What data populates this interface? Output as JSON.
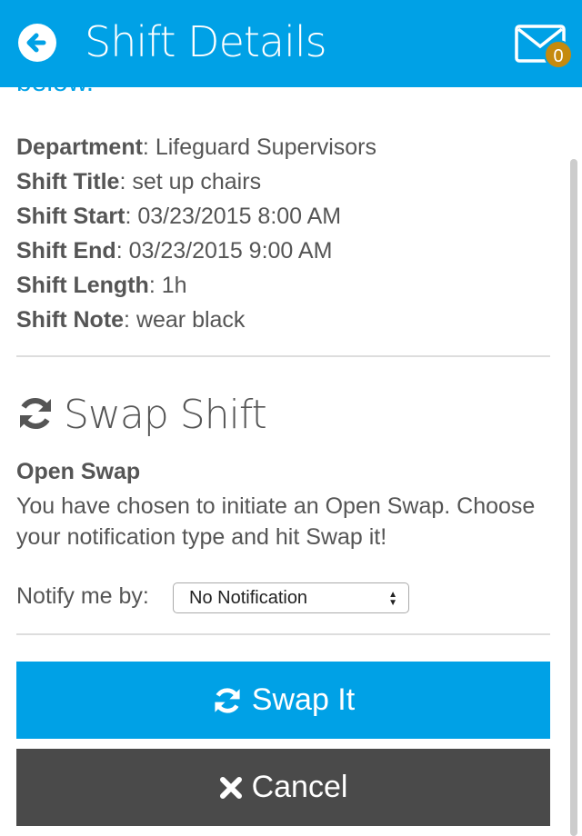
{
  "header": {
    "title": "Shift Details",
    "mail_count": "0"
  },
  "intro_cut": "below.",
  "details": [
    {
      "label": "Department",
      "value": ": Lifeguard Supervisors"
    },
    {
      "label": "Shift Title",
      "value": ": set up chairs"
    },
    {
      "label": "Shift Start",
      "value": ": 03/23/2015 8:00 AM"
    },
    {
      "label": "Shift End",
      "value": ": 03/23/2015 9:00 AM"
    },
    {
      "label": "Shift Length",
      "value": ": 1h"
    },
    {
      "label": "Shift Note",
      "value": ": wear black"
    }
  ],
  "swap": {
    "heading": "Swap Shift",
    "subheading": "Open Swap",
    "description": "You have chosen to initiate an Open Swap. Choose your notification type and hit Swap it!",
    "notify_label": "Notify me by:",
    "notify_selected": "No Notification"
  },
  "buttons": {
    "swap": "Swap It",
    "cancel": "Cancel"
  },
  "colors": {
    "accent": "#00a1e6",
    "dark_button": "#4a4a4a",
    "badge": "#c58a0e"
  }
}
